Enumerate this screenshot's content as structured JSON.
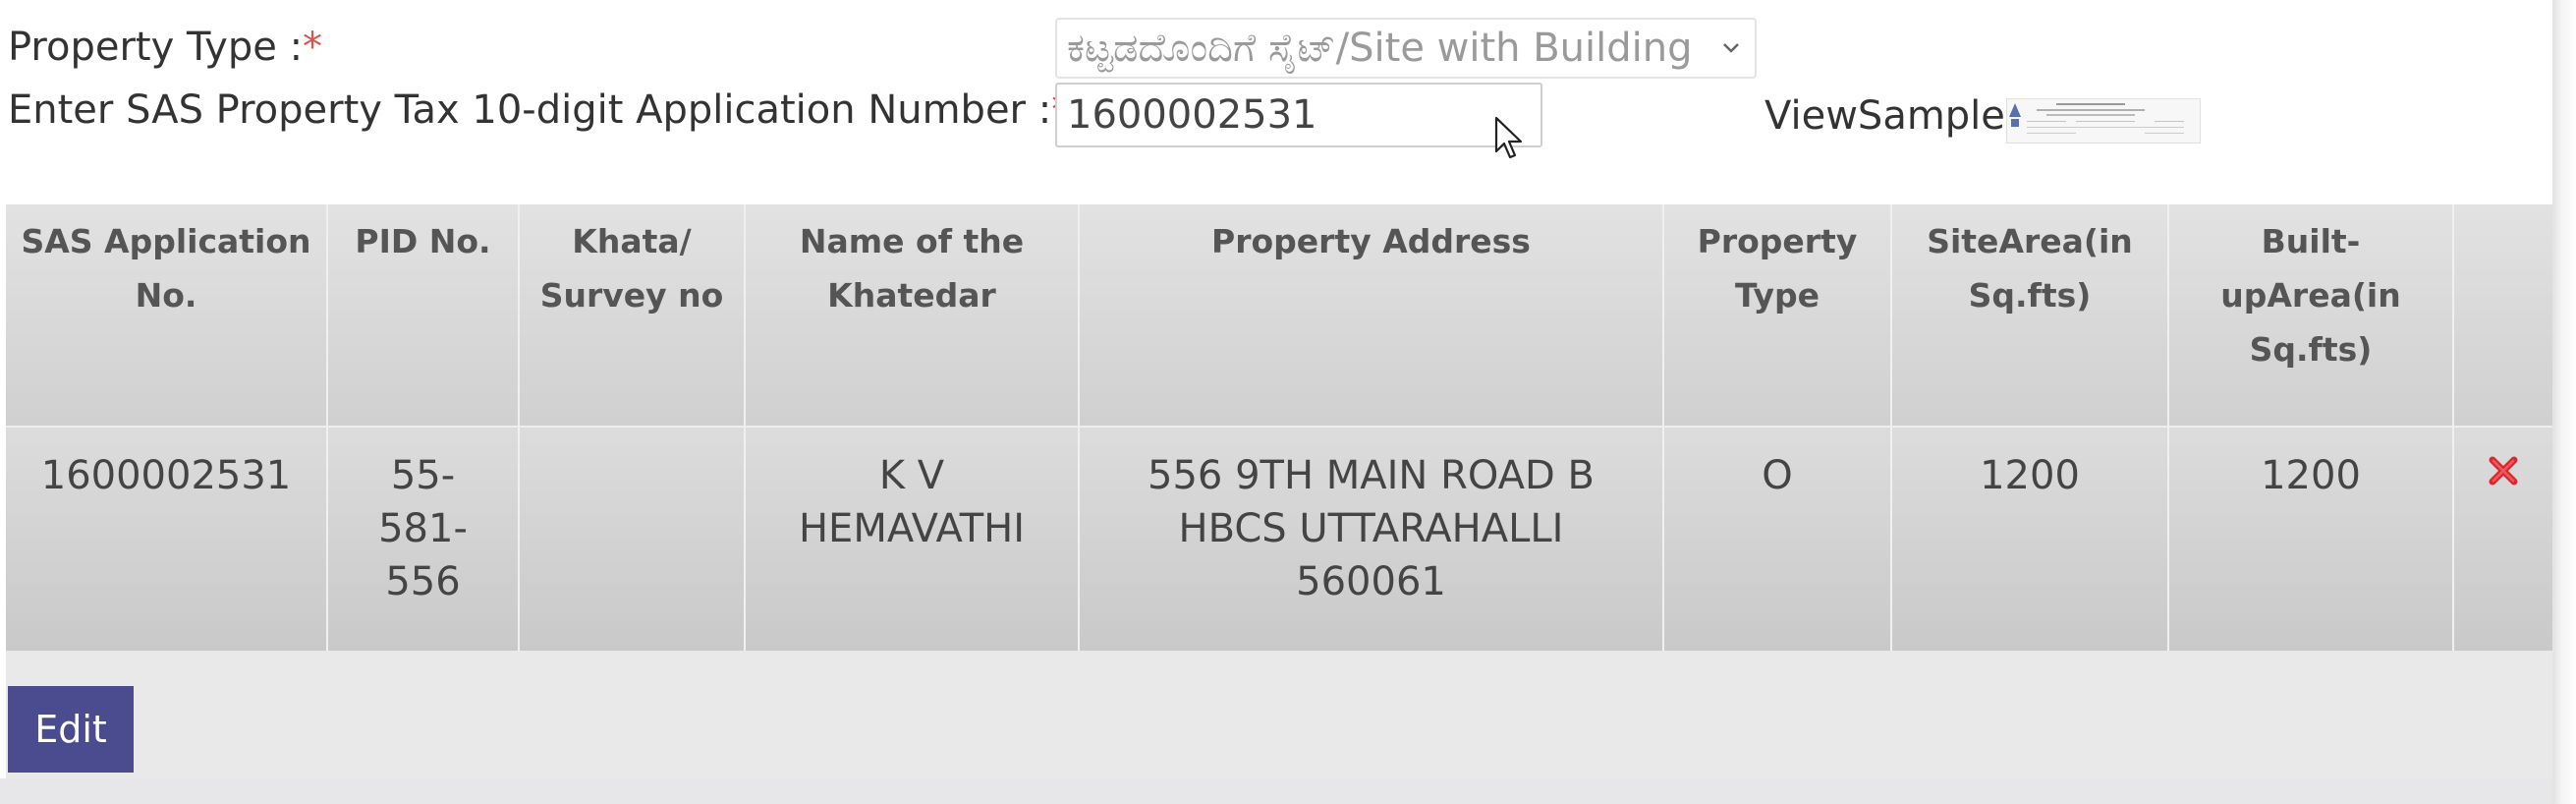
{
  "form": {
    "property_type_label": "Property Type :",
    "required_mark": "*",
    "property_type_value": "ಕಟ್ಟಡದೊಂದಿಗೆ ಸೈಟ್/Site with Building",
    "app_number_label": "Enter SAS Property Tax 10-digit Application Number :",
    "app_number_value": "1600002531",
    "view_sample_label": "ViewSample"
  },
  "table": {
    "headers": [
      "SAS Application No.",
      "PID No.",
      "Khata/ Survey no",
      "Name of the Khatedar",
      "Property Address",
      "Property Type",
      "SiteArea(in Sq.fts)",
      "Built-upArea(in Sq.fts)",
      ""
    ],
    "rows": [
      {
        "sas_application_no": "1600002531",
        "pid_no": "55-581-556",
        "khata_survey_no": "",
        "khatedar_name": "K V HEMAVATHI",
        "property_address": "556 9TH MAIN ROAD B HBCS UTTARAHALLI 560061",
        "property_type": "O",
        "site_area": "1200",
        "builtup_area": "1200",
        "action_icon": "delete-x-icon"
      }
    ]
  },
  "actions": {
    "edit_label": "Edit"
  },
  "colors": {
    "required": "#d9534f",
    "edit_button": "#4b4b8f",
    "delete_icon": "#d9282f",
    "header_bg": "#d8d8d8",
    "row_bg": "#d2d2d2"
  }
}
